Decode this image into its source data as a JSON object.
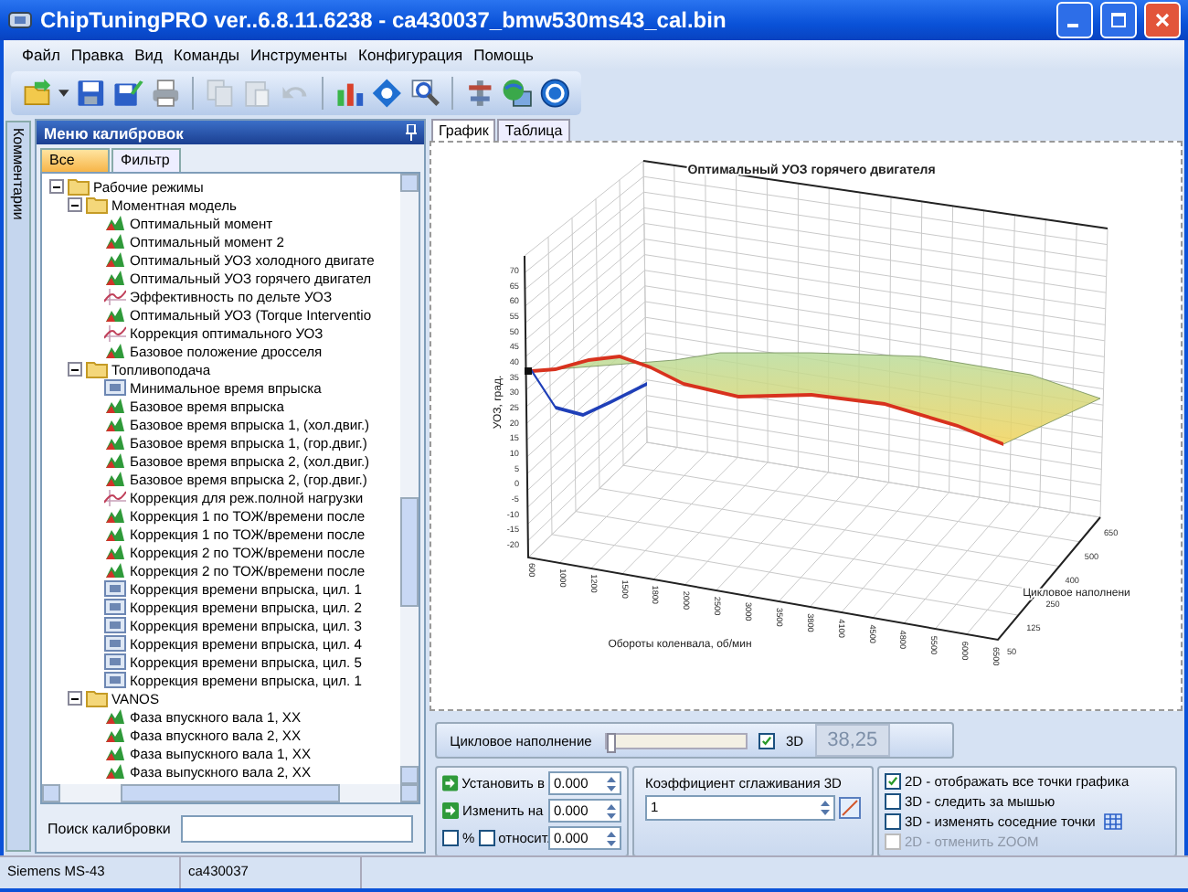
{
  "window": {
    "title": "ChipTuningPRO ver..6.8.11.6238 - ca430037_bmw530ms43_cal.bin"
  },
  "menu": [
    "Файл",
    "Правка",
    "Вид",
    "Команды",
    "Инструменты",
    "Конфигурация",
    "Помощь"
  ],
  "side_tab": {
    "label": "Комментарии"
  },
  "panel": {
    "title": "Меню калибровок",
    "tabs": [
      {
        "label": "Все",
        "selected": true
      },
      {
        "label": "Фильтр",
        "selected": false
      }
    ],
    "tree": [
      {
        "label": "Рабочие режимы",
        "kind": "folder",
        "expanded": true,
        "children": [
          {
            "label": "Моментная модель",
            "kind": "folder",
            "expanded": true,
            "children": [
              {
                "label": "Оптимальный момент",
                "kind": "map"
              },
              {
                "label": "Оптимальный момент 2",
                "kind": "map"
              },
              {
                "label": "Оптимальный УОЗ холодного двигате",
                "kind": "map"
              },
              {
                "label": "Оптимальный УОЗ горячего двигател",
                "kind": "map"
              },
              {
                "label": "Эффективность по дельте УОЗ",
                "kind": "curve"
              },
              {
                "label": "Оптимальный УОЗ (Torque Interventio",
                "kind": "map"
              },
              {
                "label": "Коррекция оптимального УОЗ",
                "kind": "curve"
              },
              {
                "label": "Базовое положение дросселя",
                "kind": "map"
              }
            ]
          },
          {
            "label": "Топливоподача",
            "kind": "folder",
            "expanded": true,
            "children": [
              {
                "label": "Минимальное время впрыска",
                "kind": "value"
              },
              {
                "label": "Базовое время впрыска",
                "kind": "map"
              },
              {
                "label": "Базовое время впрыска 1, (хол.двиг.)",
                "kind": "map"
              },
              {
                "label": "Базовое время впрыска 1, (гор.двиг.)",
                "kind": "map"
              },
              {
                "label": "Базовое время впрыска 2, (хол.двиг.)",
                "kind": "map"
              },
              {
                "label": "Базовое время впрыска 2, (гор.двиг.)",
                "kind": "map"
              },
              {
                "label": "Коррекция для реж.полной нагрузки",
                "kind": "curve"
              },
              {
                "label": "Коррекция 1 по ТОЖ/времени после",
                "kind": "map"
              },
              {
                "label": "Коррекция 1 по ТОЖ/времени после",
                "kind": "map"
              },
              {
                "label": "Коррекция 2 по ТОЖ/времени после",
                "kind": "map"
              },
              {
                "label": "Коррекция 2 по ТОЖ/времени после",
                "kind": "map"
              },
              {
                "label": "Коррекция времени впрыска, цил. 1",
                "kind": "value"
              },
              {
                "label": "Коррекция времени впрыска, цил. 2",
                "kind": "value"
              },
              {
                "label": "Коррекция времени впрыска, цил. 3",
                "kind": "value"
              },
              {
                "label": "Коррекция времени впрыска, цил. 4",
                "kind": "value"
              },
              {
                "label": "Коррекция времени впрыска, цил. 5",
                "kind": "value"
              },
              {
                "label": "Коррекция времени впрыска, цил. 1",
                "kind": "value"
              }
            ]
          },
          {
            "label": "VANOS",
            "kind": "folder",
            "expanded": true,
            "children": [
              {
                "label": "Фаза впускного вала 1, ХХ",
                "kind": "map"
              },
              {
                "label": "Фаза впускного вала 2, ХХ",
                "kind": "map"
              },
              {
                "label": "Фаза выпускного вала 1, ХХ",
                "kind": "map"
              },
              {
                "label": "Фаза выпускного вала 2, ХХ",
                "kind": "map"
              }
            ]
          }
        ]
      }
    ],
    "search": {
      "label": "Поиск калибровки"
    }
  },
  "view_tabs": [
    {
      "label": "График",
      "selected": true
    },
    {
      "label": "Таблица",
      "selected": false
    }
  ],
  "chart": {
    "title": "Оптимальный УОЗ горячего двигателя",
    "ylabel": "УОЗ, град.",
    "xlabel": "Обороты коленвала, об/мин",
    "zlabel": "Цикловое наполнени",
    "yticks": [
      "70",
      "65",
      "60",
      "55",
      "50",
      "45",
      "40",
      "35",
      "30",
      "25",
      "20",
      "15",
      "10",
      "5",
      "0",
      "-5",
      "-10",
      "-15",
      "-20"
    ],
    "xticks": [
      "600",
      "1000",
      "1200",
      "1500",
      "1800",
      "2000",
      "2500",
      "3000",
      "3500",
      "3800",
      "4100",
      "4500",
      "4800",
      "5500",
      "6000",
      "6500"
    ],
    "zticks": [
      "650",
      "500",
      "400",
      "250",
      "125",
      "50"
    ]
  },
  "axis_slider": {
    "label": "Цикловое наполнение",
    "level": 0,
    "checkbox": {
      "label": "3D",
      "checked": true
    },
    "value": "38,25"
  },
  "edit": {
    "set_button": "Установить в",
    "change_button": "Изменить на",
    "percent": {
      "label": "%",
      "checked": false
    },
    "relative": {
      "label": "относит.",
      "checked": false
    },
    "inputs": [
      "0.000",
      "0.000",
      "0.000"
    ]
  },
  "smoothing": {
    "label": "Коэффициент сглаживания 3D",
    "value": "1"
  },
  "options": [
    {
      "label": "2D - отображать все точки графика",
      "checked": true,
      "disabled": false,
      "grid_button": false
    },
    {
      "label": "3D - следить за мышью",
      "checked": false,
      "disabled": false,
      "grid_button": false
    },
    {
      "label": "3D - изменять соседние точки",
      "checked": false,
      "disabled": false,
      "grid_button": true
    },
    {
      "label": "2D - отменить ZOOM",
      "checked": false,
      "disabled": true,
      "grid_button": false
    }
  ],
  "status_bar": [
    "Siemens MS-43",
    "ca430037"
  ]
}
